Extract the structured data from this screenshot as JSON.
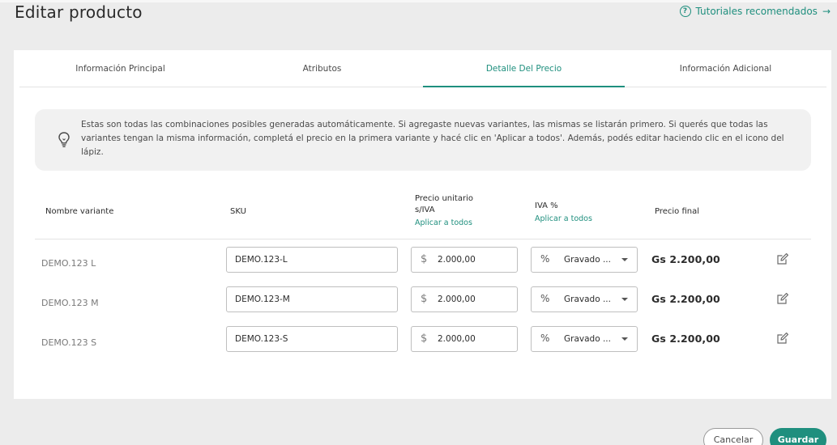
{
  "header": {
    "title": "Editar producto",
    "tutorials_link": "Tutoriales recomendados"
  },
  "tabs": [
    {
      "label": "Información Principal",
      "active": false
    },
    {
      "label": "Atributos",
      "active": false
    },
    {
      "label": "Detalle Del Precio",
      "active": true
    },
    {
      "label": "Información Adicional",
      "active": false
    }
  ],
  "info": {
    "icon": "lightbulb-icon",
    "text": "Estas son todas las combinaciones posibles generadas automáticamente. Si agregaste nuevas variantes, las mismas se listarán primero. Si querés que todas las variantes tengan la misma información, completá el precio en la primera variante y hacé clic en 'Aplicar a todos'. Además, podés editar haciendo clic en el icono del lápiz."
  },
  "table": {
    "headers": {
      "name": "Nombre variante",
      "sku": "SKU",
      "price_line1": "Precio unitario",
      "price_line2": "s/IVA",
      "price_apply": "Aplicar a todos",
      "iva": "IVA %",
      "iva_apply": "Aplicar a todos",
      "final": "Precio final"
    },
    "rows": [
      {
        "name": "DEMO.123 L",
        "sku": "DEMO.123-L",
        "currency": "$",
        "price": "2.000,00",
        "iva": "Gravado ...",
        "final": "Gs 2.200,00"
      },
      {
        "name": "DEMO.123 M",
        "sku": "DEMO.123-M",
        "currency": "$",
        "price": "2.000,00",
        "iva": "Gravado ...",
        "final": "Gs 2.200,00"
      },
      {
        "name": "DEMO.123 S",
        "sku": "DEMO.123-S",
        "currency": "$",
        "price": "2.000,00",
        "iva": "Gravado ...",
        "final": "Gs 2.200,00"
      }
    ]
  },
  "actions": {
    "cancel": "Cancelar",
    "save": "Guardar"
  },
  "colors": {
    "accent": "#1f8f7e",
    "background": "#ececec",
    "card": "#ffffff"
  }
}
